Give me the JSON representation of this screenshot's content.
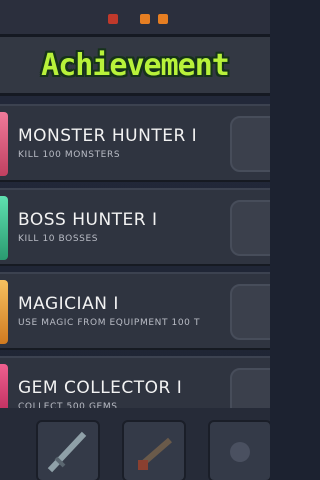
{
  "header": {
    "title": "Achievement"
  },
  "achievements": [
    {
      "title": "MONSTER HUNTER I",
      "description": "KILL 100 MONSTERS",
      "icon": "monster-icon",
      "icon_color": "#e05a7a"
    },
    {
      "title": "BOSS HUNTER I",
      "description": "KILL 10 BOSSES",
      "icon": "boss-icon",
      "icon_color": "#3fcf9a"
    },
    {
      "title": "MAGICIAN I",
      "description": "USE MAGIC FROM EQUIPMENT 100 T",
      "icon": "magic-icon",
      "icon_color": "#f0a23a"
    },
    {
      "title": "GEM COLLECTOR I",
      "description": "COLLECT 500 GEMS",
      "icon": "gem-icon",
      "icon_color": "#e0407a"
    }
  ],
  "toolbar": {
    "items": [
      {
        "icon": "sword-icon"
      },
      {
        "icon": "gun-icon"
      },
      {
        "icon": "item-icon"
      }
    ]
  },
  "colors": {
    "title_green": "#b8f23a",
    "card_bg": "#2f3440"
  }
}
